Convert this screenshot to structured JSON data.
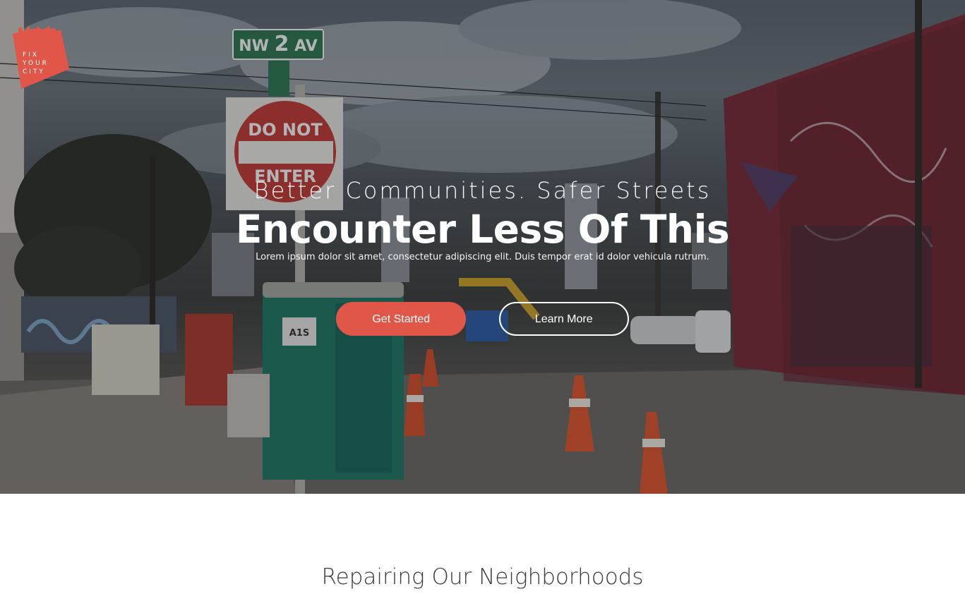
{
  "brand": {
    "logo_lines": [
      "FIX",
      "YOUR",
      "CITY"
    ],
    "color": "#e0574a"
  },
  "hero": {
    "tagline": "Better Communities. Safer Streets",
    "headline": "Encounter Less Of This",
    "lead": "Lorem ipsum dolor sit amet, consectetur adipiscing elit. Duis tempor erat id dolor vehicula rutrum.",
    "primary_button": "Get Started",
    "secondary_button": "Learn More",
    "street_sign": {
      "left": "NW",
      "number": "2",
      "right": "AV"
    },
    "stop_sign": {
      "line1": "DO NOT",
      "line2": "ENTER"
    },
    "toilet_label": "A1S"
  },
  "section": {
    "title": "Repairing Our Neighborhoods"
  },
  "colors": {
    "accent": "#e0574a",
    "text_light": "#ffffff",
    "heading_dark": "#3a3a3a"
  }
}
